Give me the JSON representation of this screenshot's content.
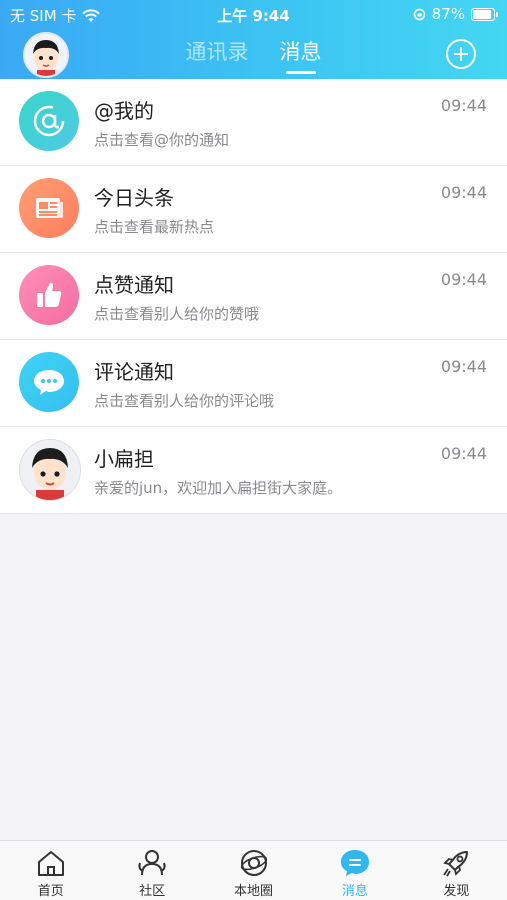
{
  "status_bar": {
    "carrier": "无 SIM 卡",
    "time": "上午 9:44",
    "battery": "87%",
    "battery_level": 0.87
  },
  "header": {
    "tabs": [
      {
        "label": "通讯录",
        "active": false
      },
      {
        "label": "消息",
        "active": true
      }
    ]
  },
  "messages": [
    {
      "title": "@我的",
      "subtitle": "点击查看@你的通知",
      "time": "09:44",
      "icon": "at-icon",
      "color": "#3fd0d3"
    },
    {
      "title": "今日头条",
      "subtitle": "点击查看最新热点",
      "time": "09:44",
      "icon": "newspaper-icon",
      "color": "#ff8b66"
    },
    {
      "title": "点赞通知",
      "subtitle": "点击查看别人给你的赞哦",
      "time": "09:44",
      "icon": "thumbs-up-icon",
      "color": "#f77eaf"
    },
    {
      "title": "评论通知",
      "subtitle": "点击查看别人给你的评论哦",
      "time": "09:44",
      "icon": "comment-bubble-icon",
      "color": "#39c9f2"
    },
    {
      "title": "小扁担",
      "subtitle": "亲爱的jun，欢迎加入扁担街大家庭。",
      "time": "09:44",
      "icon": "avatar",
      "color": "#f4f4f4"
    }
  ],
  "tabbar": {
    "items": [
      {
        "label": "首页",
        "icon": "home-icon",
        "active": false
      },
      {
        "label": "社区",
        "icon": "community-icon",
        "active": false
      },
      {
        "label": "本地圈",
        "icon": "planet-icon",
        "active": false
      },
      {
        "label": "消息",
        "icon": "message-icon",
        "active": true
      },
      {
        "label": "发现",
        "icon": "rocket-icon",
        "active": false
      }
    ],
    "active_color": "#2fb7ee"
  }
}
